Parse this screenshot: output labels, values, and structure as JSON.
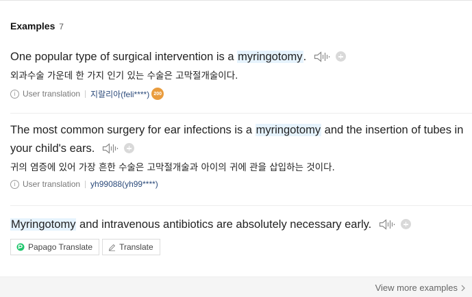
{
  "header": {
    "title": "Examples",
    "count": "7"
  },
  "examples": [
    {
      "pre": "One popular type of surgical intervention is a ",
      "highlight": "myringotomy",
      "post": ".",
      "translation": "외과수술 가운데 한 가지 인기 있는 수술은 고막절개술이다.",
      "source_label": "User translation",
      "user": "지랄리아(feli****)",
      "badge": "200"
    },
    {
      "pre": "The most common surgery for ear infections is a ",
      "highlight": "myringotomy",
      "post": " and the insertion of tubes in your child's ears.",
      "translation": "귀의 염증에 있어 가장 흔한 수술은 고막절개술과 아이의 귀에 관을 삽입하는 것이다.",
      "source_label": "User translation",
      "user": "yh99088(yh99****)"
    },
    {
      "pre": "",
      "highlight": "Myringotomy",
      "post": " and intravenous antibiotics are absolutely necessary early."
    }
  ],
  "buttons": {
    "papago": "Papago Translate",
    "translate": "Translate"
  },
  "footer": {
    "more_label": "View more examples"
  },
  "icons": {
    "speaker": "speaker-icon",
    "add": "plus-icon",
    "info": "info-icon",
    "papago": "papago-logo-icon",
    "translate": "pen-icon",
    "more": "chevron-right-icon"
  },
  "colors": {
    "highlight_bg": "#e6f3fd",
    "user_link": "#2b4a7a",
    "badge": "#e99c3e"
  }
}
